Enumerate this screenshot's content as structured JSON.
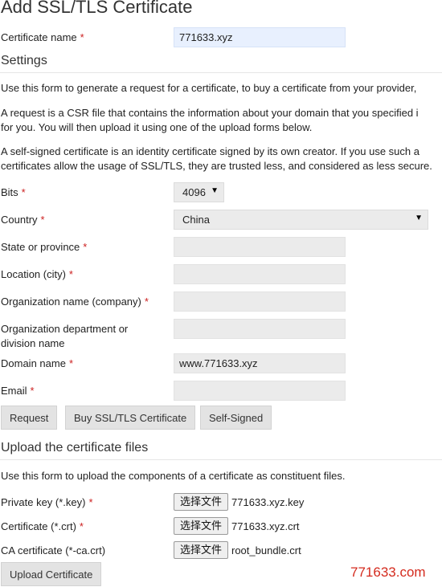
{
  "page_title": "Add SSL/TLS Certificate",
  "certificate_name": {
    "label": "Certificate name",
    "value": "771633.xyz"
  },
  "settings": {
    "title": "Settings",
    "paragraphs": [
      "Use this form to generate a request for a certificate, to buy a certificate from your provider,",
      "A request is a CSR file that contains the information about your domain that you specified i",
      "for you. You will then upload it using one of the upload forms below.",
      "A self-signed certificate is an identity certificate signed by its own creator. If you use such a",
      "certificates allow the usage of SSL/TLS, they are trusted less, and considered as less secure."
    ]
  },
  "required_marker": "*",
  "fields": {
    "bits": {
      "label": "Bits",
      "value": "4096"
    },
    "country": {
      "label": "Country",
      "value": "China"
    },
    "state": {
      "label": "State or province",
      "value": ""
    },
    "location": {
      "label": "Location (city)",
      "value": ""
    },
    "org_name": {
      "label": "Organization name (company)",
      "value": ""
    },
    "org_dept": {
      "label_line1": "Organization department or",
      "label_line2": "division name",
      "value": ""
    },
    "domain": {
      "label": "Domain name",
      "value": "www.771633.xyz"
    },
    "email": {
      "label": "Email",
      "value": ""
    }
  },
  "actions": {
    "request": "Request",
    "buy": "Buy SSL/TLS Certificate",
    "self_signed": "Self-Signed"
  },
  "upload": {
    "title": "Upload the certificate files",
    "description": "Use this form to upload the components of a certificate as constituent files.",
    "choose_file_label": "选择文件",
    "private_key": {
      "label": "Private key (*.key)",
      "file": "771633.xyz.key"
    },
    "certificate": {
      "label": "Certificate (*.crt)",
      "file": "771633.xyz.crt"
    },
    "ca_certificate": {
      "label": "CA certificate (*-ca.crt)",
      "file": "root_bundle.crt"
    },
    "submit": "Upload Certificate"
  },
  "watermark": "771633.com"
}
